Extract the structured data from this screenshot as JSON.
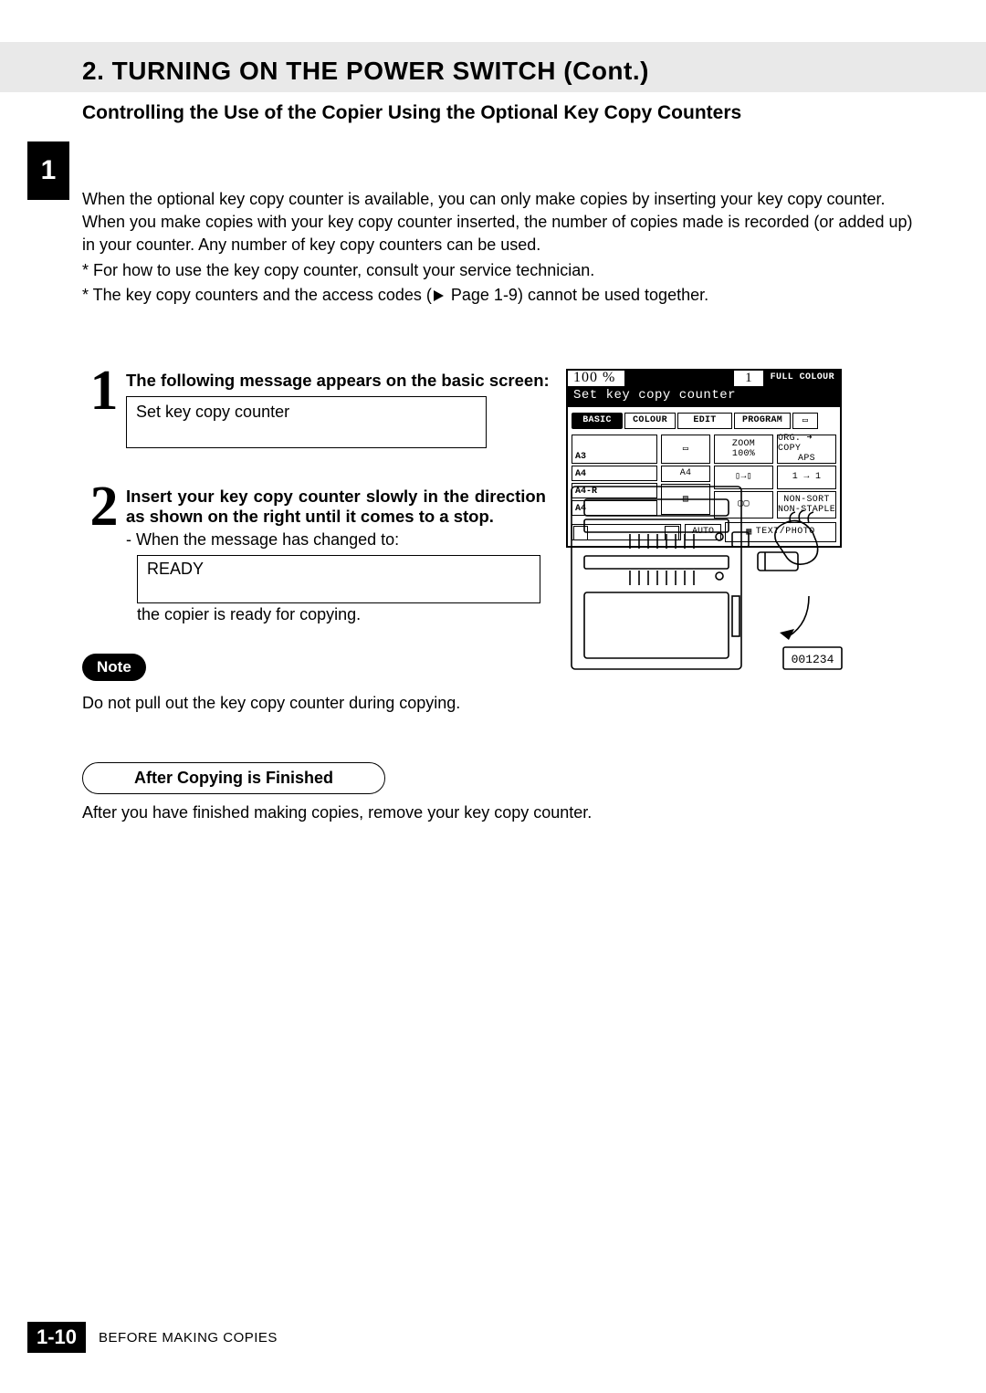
{
  "header": {
    "section_title": "2. TURNING ON THE POWER SWITCH (Cont.)",
    "subsection_title": "Controlling the Use of the Copier Using the Optional Key Copy Counters",
    "chapter_tab": "1"
  },
  "intro": {
    "p1": "When the optional key copy counter is available, you can only make copies by inserting your key copy counter. When you make copies with your key copy counter inserted, the number of copies made is recorded (or added up) in your counter. Any number of key copy counters can be used.",
    "b1": "* For how to use the key copy counter, consult your service technician.",
    "b2_pre": "* The key copy counters and the access codes (",
    "b2_post": " Page 1-9) cannot be used together."
  },
  "step1": {
    "num": "1",
    "heading": "The following message appears on the basic screen:",
    "message": "Set key copy counter"
  },
  "lcd": {
    "percent": "100  %",
    "count": "1",
    "full_colour": "FULL COLOUR",
    "status": "Set key copy counter",
    "tabs": {
      "basic": "BASIC",
      "colour": "COLOUR",
      "edit": "EDIT",
      "program": "PROGRAM"
    },
    "trays": {
      "a3": "A3",
      "a4top": "A4",
      "a4r": "A4-R",
      "a4": "A4"
    },
    "zoom": "ZOOM",
    "zoom_val": "100%",
    "org_copy": "ORG. ➜ COPY",
    "aps": "APS",
    "one_one": "1 → 1",
    "nonsort": "NON-SORT",
    "nonstaple": "NON-STAPLE",
    "auto": "AUTO",
    "textphoto": "TEXT/PHOTO"
  },
  "step2": {
    "num": "2",
    "heading": "Insert your key copy counter slowly in the direction as shown on the right until it comes to a stop.",
    "dash": "- When the message has changed to:",
    "message": "READY",
    "after": "the copier is ready for copying.",
    "counter_digits": "001234"
  },
  "note": {
    "label": "Note",
    "text": "Do not pull out the key copy counter during copying."
  },
  "after_section": {
    "heading": "After Copying is Finished",
    "text": "After you have finished making copies, remove your key copy counter."
  },
  "footer": {
    "page": "1-10",
    "caption": "BEFORE MAKING COPIES"
  }
}
